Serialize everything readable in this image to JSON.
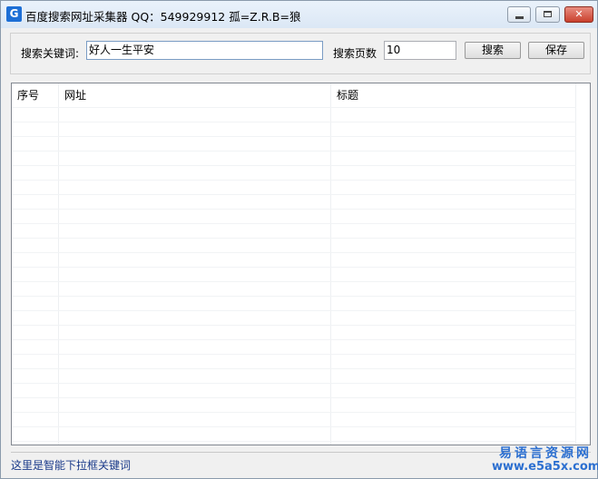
{
  "window": {
    "icon_letter": "G",
    "title": "百度搜索网址采集器 QQ：549929912 孤=Z.R.B=狼",
    "minimize_glyph": "",
    "maximize_glyph": "",
    "close_glyph": "✕"
  },
  "toolbar": {
    "keyword_label": "搜索关键词:",
    "keyword_value": "好人一生平安",
    "pages_label": "搜索页数",
    "pages_value": "10",
    "search_label": "搜索",
    "save_label": "保存"
  },
  "results": {
    "columns": [
      "序号",
      "网址",
      "标题"
    ],
    "rows": []
  },
  "status": {
    "text": "这里是智能下拉框关键词"
  },
  "watermark": {
    "line1": "易语言资源网",
    "line2": "www.e5a5x.com"
  }
}
